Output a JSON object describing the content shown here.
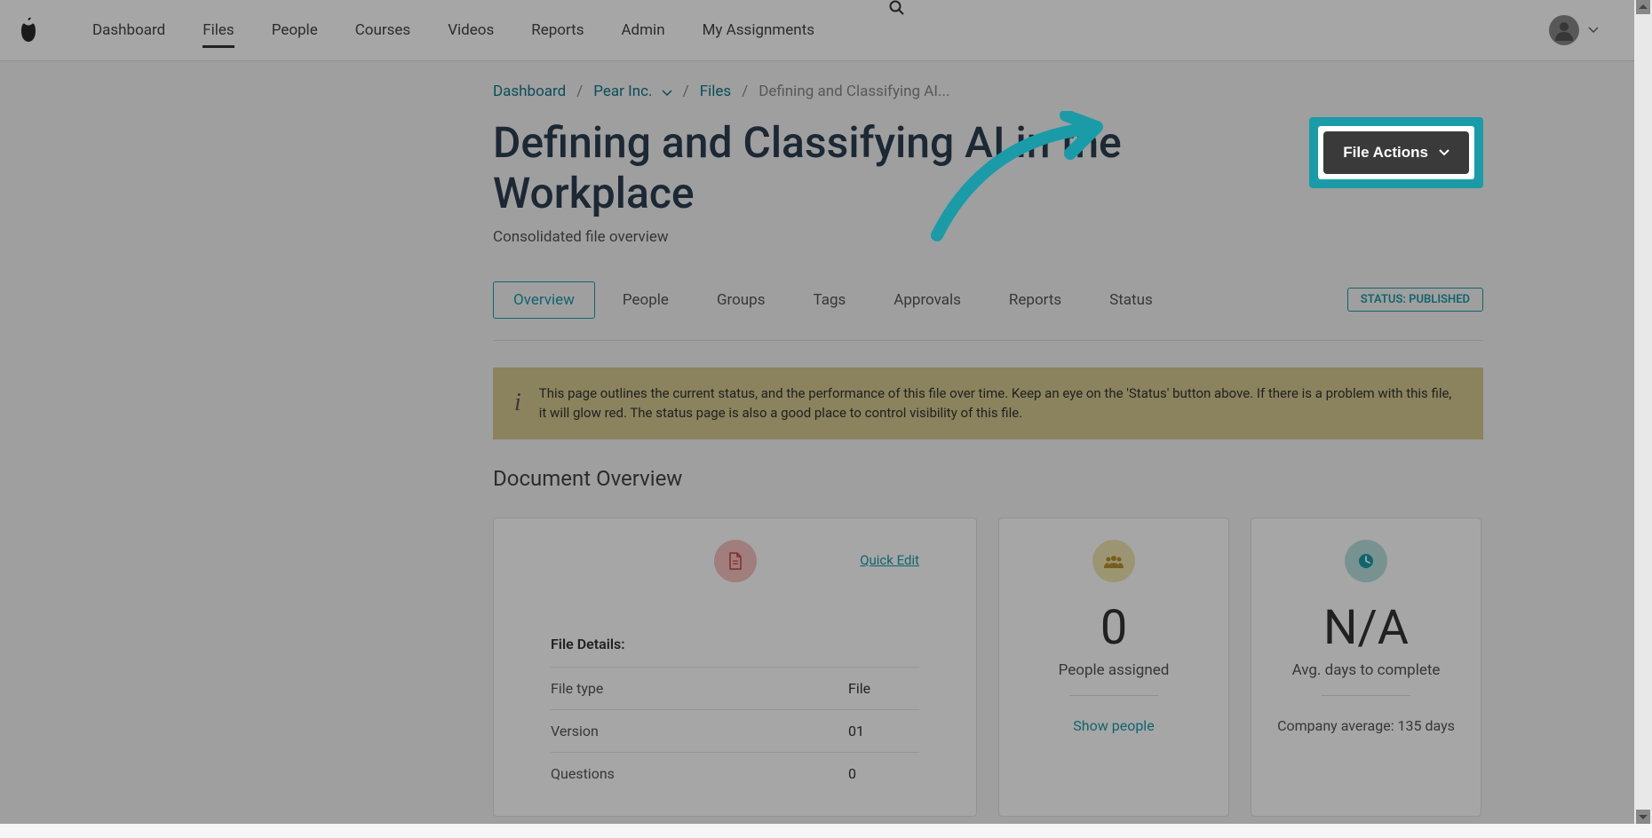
{
  "nav": {
    "items": [
      "Dashboard",
      "Files",
      "People",
      "Courses",
      "Videos",
      "Reports",
      "Admin",
      "My Assignments"
    ],
    "active_index": 1
  },
  "breadcrumb": {
    "dashboard": "Dashboard",
    "org": "Pear Inc.",
    "files": "Files",
    "current": "Defining and Classifying AI..."
  },
  "page": {
    "title": "Defining and Classifying AI in the Workplace",
    "subtitle": "Consolidated file overview"
  },
  "file_actions": {
    "label": "File Actions"
  },
  "tabs": {
    "items": [
      "Overview",
      "People",
      "Groups",
      "Tags",
      "Approvals",
      "Reports",
      "Status"
    ],
    "active_index": 0
  },
  "status_badge": "STATUS: PUBLISHED",
  "info_banner": "This page outlines the current status, and the performance of this file over time. Keep an eye on the 'Status' button above. If there is a problem with this file, it will glow red. The status page is also a good place to control visibility of this file.",
  "section_heading": "Document Overview",
  "card_document": {
    "quick_edit": "Quick Edit",
    "details_heading": "File Details:",
    "rows": [
      {
        "label": "File type",
        "value": "File"
      },
      {
        "label": "Version",
        "value": "01"
      },
      {
        "label": "Questions",
        "value": "0"
      }
    ]
  },
  "card_people": {
    "value": "0",
    "label": "People assigned",
    "link": "Show people"
  },
  "card_days": {
    "value": "N/A",
    "label": "Avg. days to complete",
    "footer_prefix": "Company average:  ",
    "footer_value": "135 days"
  }
}
